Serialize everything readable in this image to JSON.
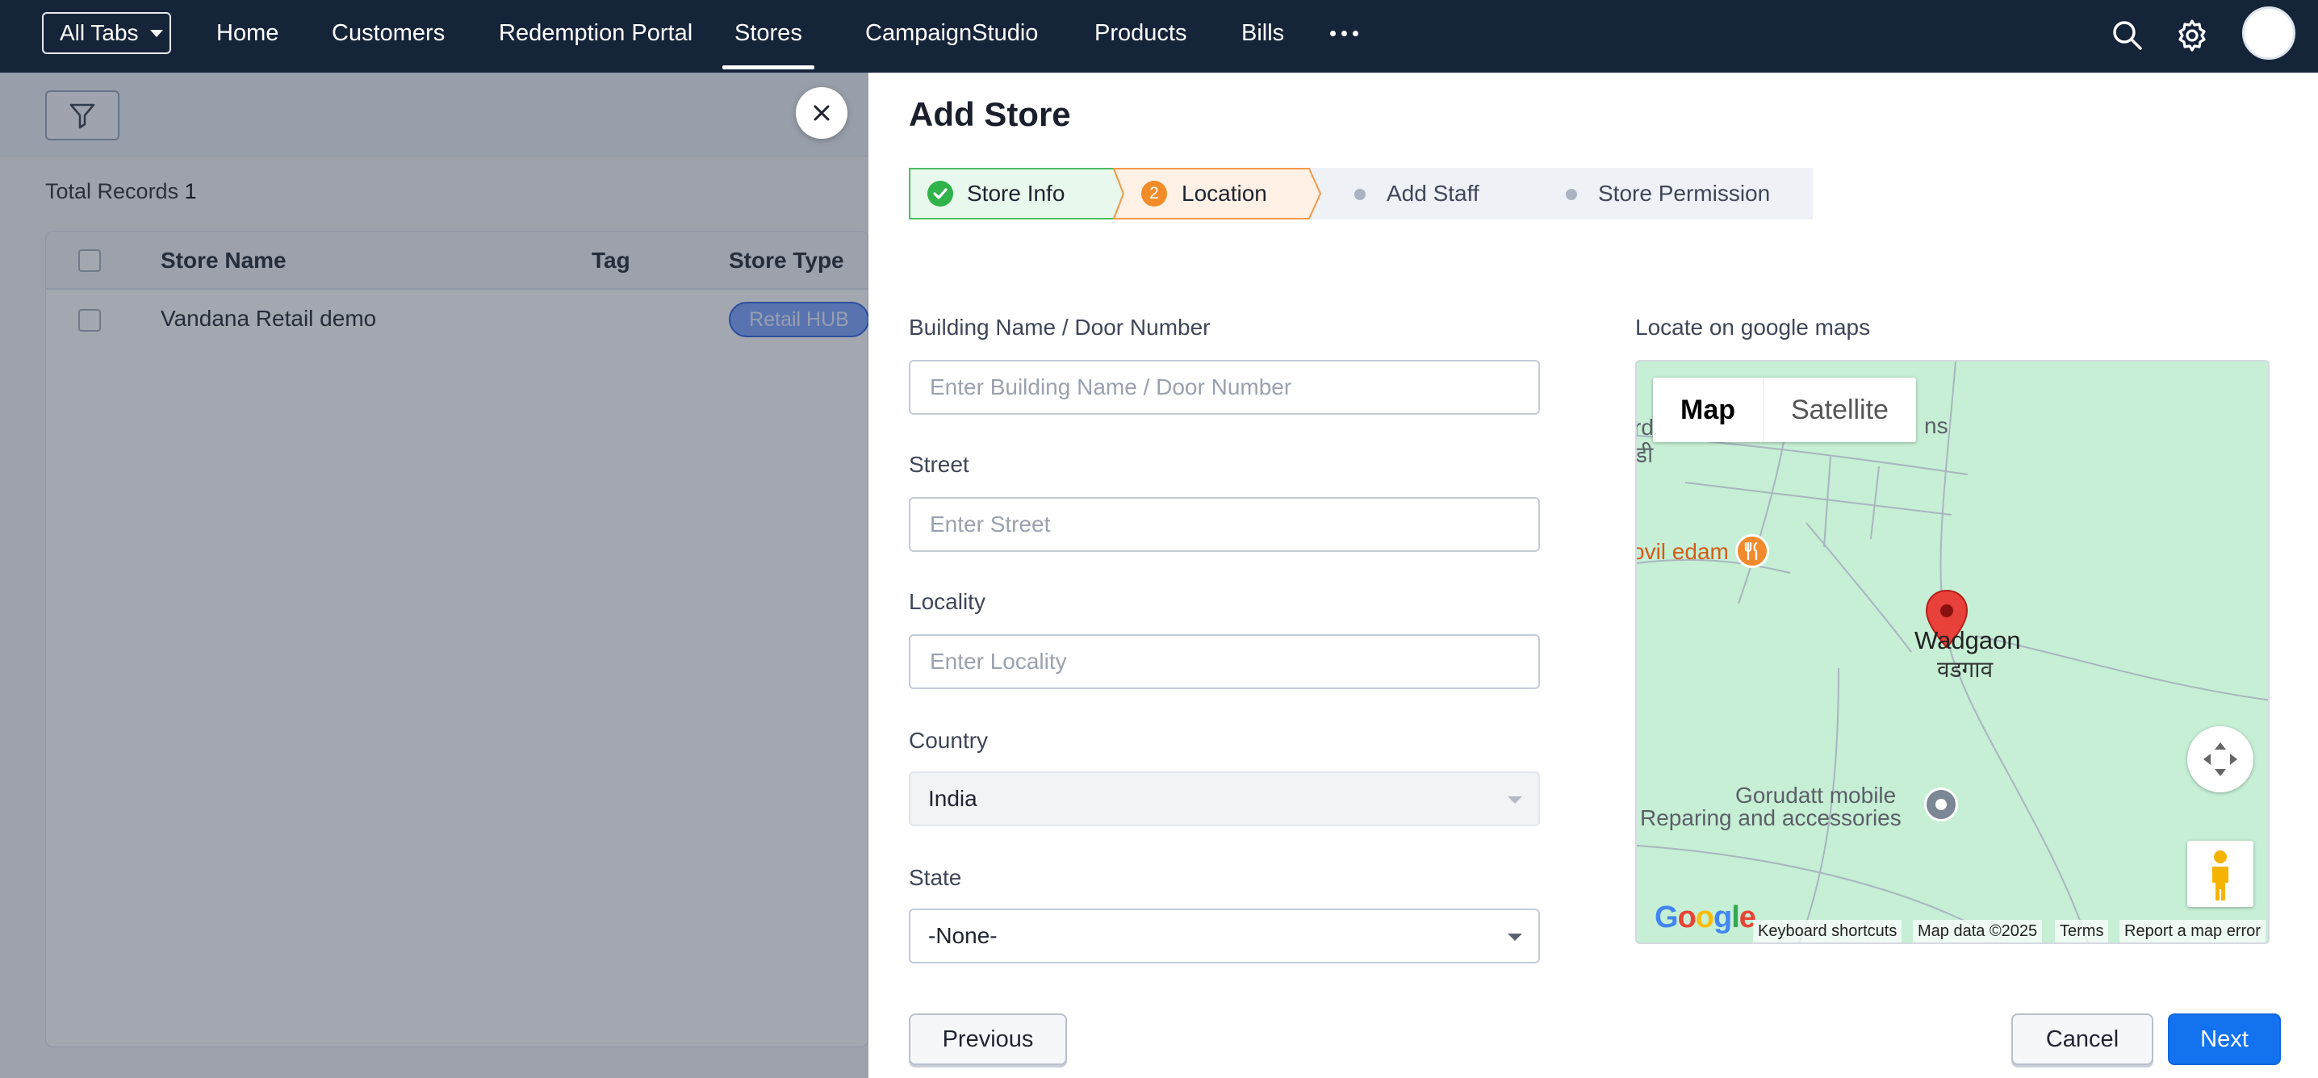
{
  "nav": {
    "all_tabs": "All Tabs",
    "items": [
      "Home",
      "Customers",
      "Redemption Portal",
      "Stores",
      "CampaignStudio",
      "Products",
      "Bills"
    ],
    "active": "Stores",
    "icons": [
      "more-icon",
      "search-icon",
      "gear-icon",
      "avatar"
    ]
  },
  "list": {
    "total_label": "Total Records",
    "total_count": "1",
    "columns": [
      "Store Name",
      "Tag",
      "Store Type"
    ],
    "rows": [
      {
        "store_name": "Vandana Retail demo",
        "tag": "",
        "store_type": "Retail HUB"
      }
    ]
  },
  "panel": {
    "title": "Add Store",
    "steps": [
      {
        "label": "Store Info",
        "state": "done"
      },
      {
        "label": "Location",
        "state": "current",
        "number": "2"
      },
      {
        "label": "Add Staff",
        "state": "pending"
      },
      {
        "label": "Store Permission",
        "state": "pending"
      }
    ],
    "fields": {
      "building": {
        "label": "Building Name / Door Number",
        "placeholder": "Enter Building Name / Door Number",
        "value": ""
      },
      "street": {
        "label": "Street",
        "placeholder": "Enter Street",
        "value": ""
      },
      "locality": {
        "label": "Locality",
        "placeholder": "Enter Locality",
        "value": ""
      },
      "country": {
        "label": "Country",
        "value": "India",
        "disabled": true
      },
      "state": {
        "label": "State",
        "value": "-None-"
      }
    },
    "map": {
      "label": "Locate on google maps",
      "type_map": "Map",
      "type_satellite": "Satellite",
      "selected_type": "Map",
      "places": {
        "top_left_1": "rd",
        "top_left_2": "डी",
        "top_right": "ns",
        "restaurant": "ovil edam",
        "village": "Wadgaon",
        "village_local": "वडगाव",
        "shop_1": "Gorudatt mobile",
        "shop_2": "Reparing and accessories"
      },
      "logo": "Google",
      "attribution": [
        "Keyboard shortcuts",
        "Map data ©2025",
        "Terms",
        "Report a map error"
      ]
    },
    "buttons": {
      "previous": "Previous",
      "cancel": "Cancel",
      "next": "Next"
    },
    "colors": {
      "primary": "#1372f0",
      "step_done": "#2fb34a",
      "step_current": "#f28c28"
    }
  }
}
